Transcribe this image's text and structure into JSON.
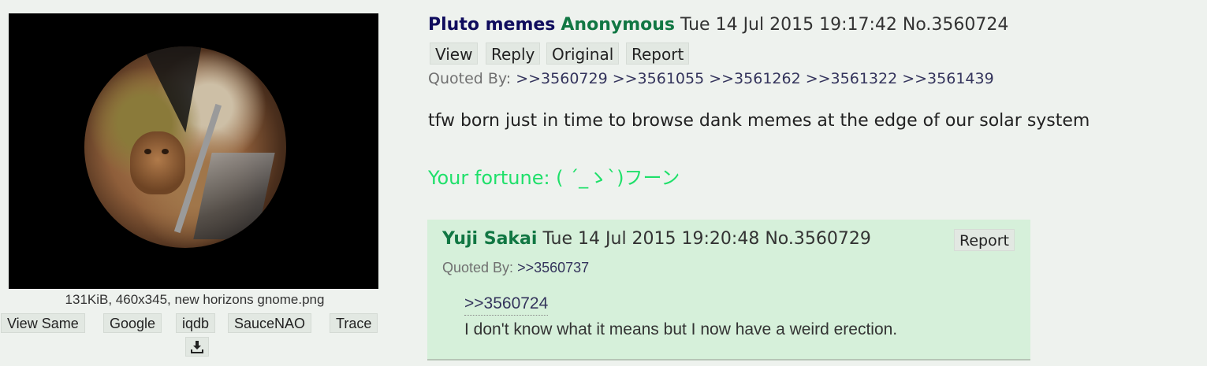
{
  "file": {
    "info": "131KiB, 460x345, new horizons gnome.png",
    "actions": [
      "View Same",
      "Google",
      "iqdb",
      "SauceNAO",
      "Trace"
    ],
    "download_icon": "download-icon"
  },
  "post": {
    "subject": "Pluto memes",
    "name": "Anonymous",
    "datetime": "Tue 14 Jul 2015 19:17:42",
    "number": "No.3560724",
    "buttons": [
      "View",
      "Reply",
      "Original",
      "Report"
    ],
    "quoted_by_label": "Quoted By:",
    "quoted_by": ">>3560729 >>3561055 >>3561262 >>3561322 >>3561439",
    "body": "tfw born just in time to browse dank memes at the edge of our solar system",
    "fortune": "Your fortune: ( ´_ゝ`)フーン"
  },
  "reply": {
    "name": "Yuji Sakai",
    "datetime": "Tue 14 Jul 2015 19:20:48",
    "number": "No.3560729",
    "report_label": "Report",
    "quoted_by_label": "Quoted By:",
    "quoted_by": ">>3560737",
    "quotelink": ">>3560724",
    "body": "I don't know what it means but I now have a weird erection."
  },
  "colors": {
    "background": "#eef2ee",
    "subject": "#0f0c5d",
    "name": "#117743",
    "fortune": "#1fe06a",
    "reply_bg": "#d6f0da"
  }
}
